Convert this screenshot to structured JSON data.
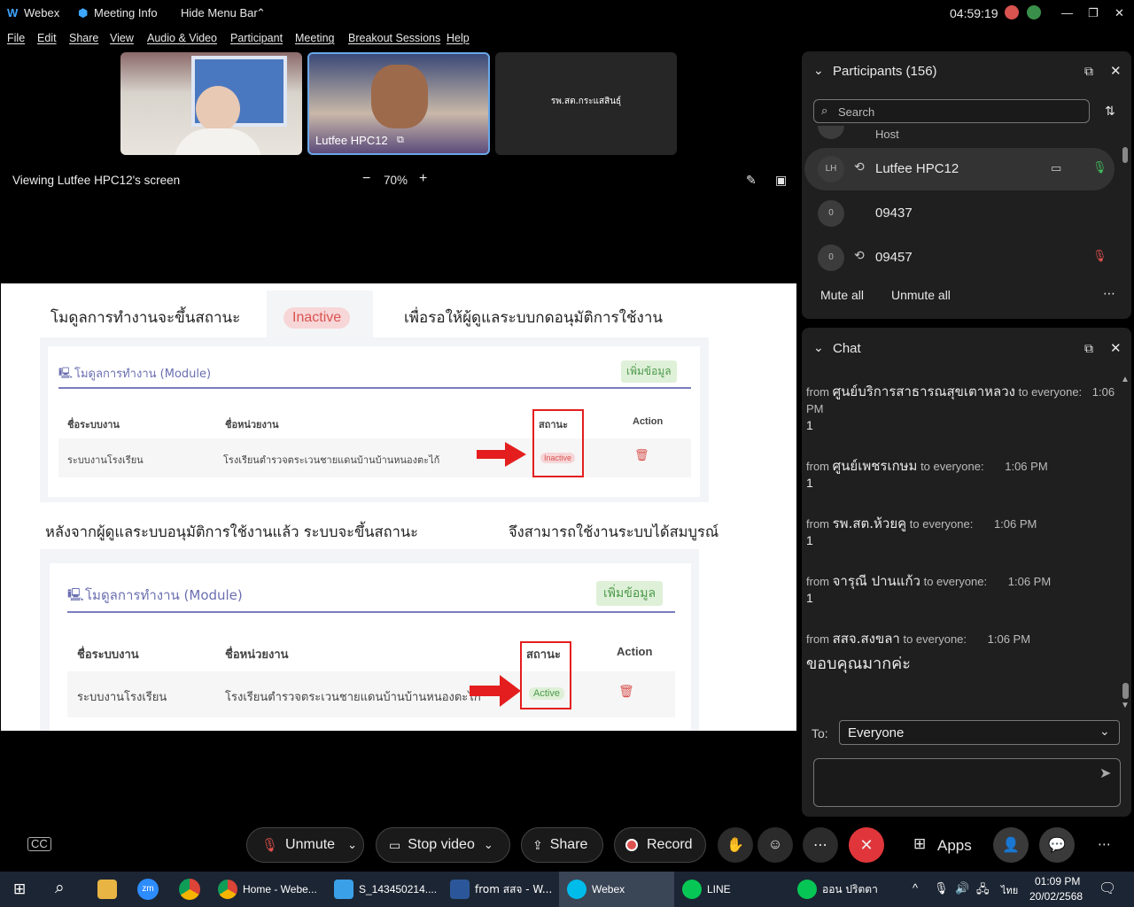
{
  "titlebar": {
    "app": "Webex",
    "meeting_info": "Meeting Info",
    "hide_menu": "Hide Menu Bar",
    "clock": "04:59:19"
  },
  "menu": [
    "File",
    "Edit",
    "Share",
    "View",
    "Audio & Video",
    "Participant",
    "Meeting",
    "Breakout Sessions",
    "Help"
  ],
  "tiles": {
    "t2_name": "Lutfee HPC12",
    "t3_name": "รพ.สต.กระแสสินธุ์"
  },
  "viewbar": {
    "viewing": "Viewing Lutfee HPC12's screen",
    "zoom": "70%"
  },
  "slide": {
    "h1a": "โมดูลการทำงานจะขึ้นสถานะ",
    "badge_inactive": "Inactive",
    "h1b": "เพื่อรอให้ผู้ดูแลระบบกดอนุมัติการใช้งาน",
    "module_title": "โมดูลการทำงาน (Module)",
    "add_btn": "เพิ่มข้อมูล",
    "col1": "ชื่อระบบงาน",
    "col2": "ชื่อหน่วยงาน",
    "col3": "สถานะ",
    "col4": "Action",
    "row_sys": "ระบบงานโรงเรียน",
    "row_unit": "โรงเรียนตำรวจตระเวนชายแดนบ้านบ้านหนองตะไก้",
    "status_inactive": "Inactive",
    "status_active": "Active",
    "h2a": "หลังจากผู้ดูแลระบบอนุมัติการใช้งานแล้ว ระบบจะขึ้นสถานะ",
    "h2b": "จึงสามารถใช้งานระบบได้สมบูรณ์"
  },
  "participants": {
    "title": "Participants (156)",
    "search_placeholder": "Search",
    "host_label": "Host",
    "list": [
      {
        "initials": "LH",
        "name": "Lutfee HPC12"
      },
      {
        "initials": "0",
        "name": "09437"
      },
      {
        "initials": "0",
        "name": "09457"
      }
    ],
    "mute_all": "Mute all",
    "unmute_all": "Unmute all"
  },
  "chat": {
    "title": "Chat",
    "messages": [
      {
        "from": "from",
        "sender": "ศูนย์บริการสาธารณสุขเตาหลวง",
        "to": "to everyone:",
        "time": "1:06 PM",
        "body": "1"
      },
      {
        "from": "from",
        "sender": "ศูนย์เพชรเกษม",
        "to": "to everyone:",
        "time": "1:06 PM",
        "body": "1"
      },
      {
        "from": "from",
        "sender": "รพ.สต.ห้วยคู",
        "to": "to everyone:",
        "time": "1:06 PM",
        "body": "1"
      },
      {
        "from": "from",
        "sender": "จารุณี ปานแก้ว",
        "to": "to everyone:",
        "time": "1:06 PM",
        "body": "1"
      },
      {
        "from": "from",
        "sender": "สสจ.สงขลา",
        "to": "to everyone:",
        "time": "1:06 PM",
        "body": "ขอบคุณมากค่ะ"
      }
    ],
    "to_label": "To:",
    "to_value": "Everyone"
  },
  "controls": {
    "unmute": "Unmute",
    "stop_video": "Stop video",
    "share": "Share",
    "record": "Record",
    "apps": "Apps"
  },
  "taskbar": {
    "items": [
      "Home - Webe...",
      "S_143450214....",
      "from สสจ - W...",
      "Webex",
      "LINE",
      "ออน ปริตตา"
    ],
    "lang": "ไทย",
    "time": "01:09 PM",
    "date": "20/02/2568"
  }
}
